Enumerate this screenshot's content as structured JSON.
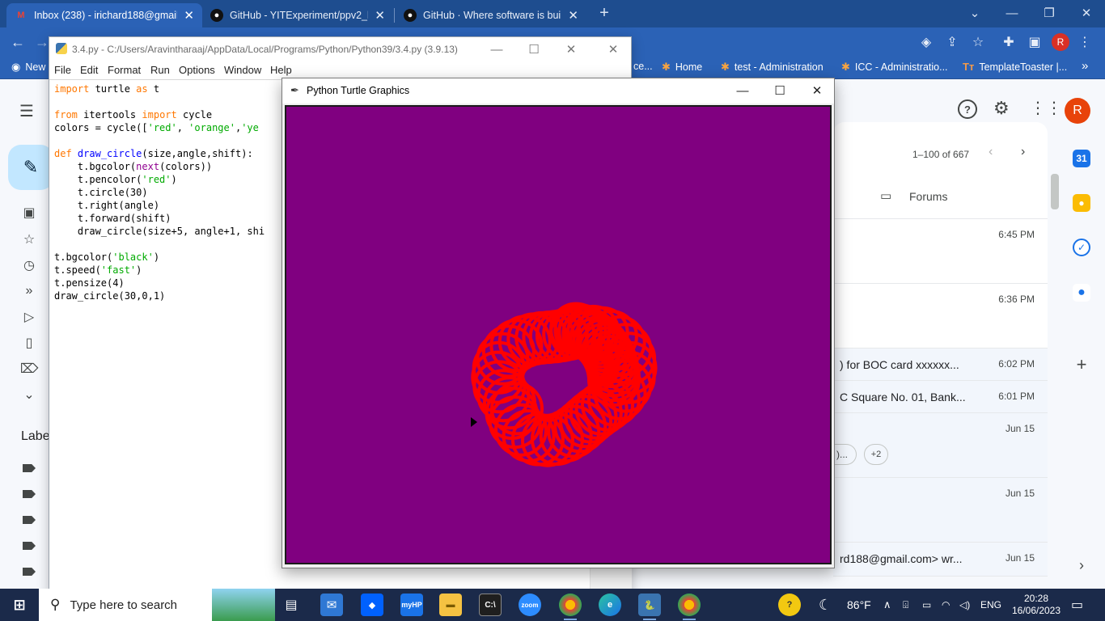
{
  "chrome": {
    "tabs": [
      {
        "title": "Inbox (238) - irichard188@gmail.",
        "favicon": "gmail-icon",
        "active": true
      },
      {
        "title": "GitHub - YITExperiment/ppv2_le",
        "favicon": "github-icon",
        "active": false
      },
      {
        "title": "GitHub · Where software is built",
        "favicon": "github-icon",
        "active": false
      }
    ],
    "new_tab": "+",
    "profile_initial": "R",
    "bookmarks": [
      {
        "label": "New",
        "icon": "chrome-icon"
      },
      {
        "label": "ce...",
        "icon": "none"
      },
      {
        "label": "Home",
        "icon": "joomla-icon"
      },
      {
        "label": "test - Administration",
        "icon": "joomla-icon"
      },
      {
        "label": "ICC - Administratio...",
        "icon": "joomla-icon"
      },
      {
        "label": "TemplateToaster |...",
        "icon": "templatetoaster-icon"
      }
    ],
    "bookmarks_more": "»"
  },
  "gmail": {
    "pagination": "1–100 of 667",
    "tab_forums": "Forums",
    "labels_heading": "Labe",
    "profile_initial": "R",
    "emails": [
      {
        "snippet": "",
        "date": "6:45 PM",
        "read": false
      },
      {
        "snippet": "",
        "date": "6:36 PM",
        "read": false
      },
      {
        "snippet": ") for BOC card xxxxxx...",
        "date": "6:02 PM",
        "read": true
      },
      {
        "snippet": "C Square No. 01, Bank...",
        "date": "6:01 PM",
        "read": true
      },
      {
        "snippet": "",
        "date": "Jun 15",
        "read": true,
        "chip": ")...",
        "chip_more": "+2"
      },
      {
        "snippet": "",
        "date": "Jun 15",
        "read": true
      },
      {
        "snippet": "rd188@gmail.com> wr...",
        "date": "Jun 15",
        "read": true
      }
    ]
  },
  "idle": {
    "title": "3.4.py - C:/Users/Aravintharaaj/AppData/Local/Programs/Python/Python39/3.4.py (3.9.13)",
    "menu": [
      "File",
      "Edit",
      "Format",
      "Run",
      "Options",
      "Window",
      "Help"
    ],
    "code": [
      [
        [
          "kw",
          "import"
        ],
        [
          "t",
          " turtle "
        ],
        [
          "kw",
          "as"
        ],
        [
          "t",
          " t"
        ]
      ],
      [],
      [
        [
          "kw",
          "from"
        ],
        [
          "t",
          " itertools "
        ],
        [
          "kw",
          "import"
        ],
        [
          "t",
          " cycle"
        ]
      ],
      [
        [
          "t",
          "colors = cycle(["
        ],
        [
          "str",
          "'red'"
        ],
        [
          "t",
          ", "
        ],
        [
          "str",
          "'orange'"
        ],
        [
          "t",
          ","
        ],
        [
          "str",
          "'ye"
        ]
      ],
      [],
      [
        [
          "kw",
          "def"
        ],
        [
          "t",
          " "
        ],
        [
          "def",
          "draw_circle"
        ],
        [
          "t",
          "(size,angle,shift):"
        ]
      ],
      [
        [
          "t",
          "    t.bgcolor("
        ],
        [
          "bi",
          "next"
        ],
        [
          "t",
          "(colors))"
        ]
      ],
      [
        [
          "t",
          "    t.pencolor("
        ],
        [
          "str",
          "'red'"
        ],
        [
          "t",
          ")"
        ]
      ],
      [
        [
          "t",
          "    t.circle(30)"
        ]
      ],
      [
        [
          "t",
          "    t.right(angle)"
        ]
      ],
      [
        [
          "t",
          "    t.forward(shift)"
        ]
      ],
      [
        [
          "t",
          "    draw_circle(size+5, angle+1, shi"
        ]
      ],
      [],
      [
        [
          "t",
          "t.bgcolor("
        ],
        [
          "str",
          "'black'"
        ],
        [
          "t",
          ")"
        ]
      ],
      [
        [
          "t",
          "t.speed("
        ],
        [
          "str",
          "'fast'"
        ],
        [
          "t",
          ")"
        ]
      ],
      [
        [
          "t",
          "t.pensize(4)"
        ]
      ],
      [
        [
          "t",
          "draw_circle(30,0,1)"
        ]
      ]
    ]
  },
  "turtle": {
    "title": "Python Turtle Graphics",
    "background_color": "#800080",
    "pen_color": "#ff0000"
  },
  "taskbar": {
    "search_placeholder": "Type here to search",
    "weather": "86°F",
    "language": "ENG",
    "time": "20:28",
    "date": "16/06/2023",
    "apps": [
      "task-view-icon",
      "mail-icon",
      "dropbox-icon",
      "myhp-icon",
      "file-explorer-icon",
      "terminal-icon",
      "zoom-icon",
      "chrome-profile-icon",
      "edge-icon",
      "python-idle-icon",
      "chrome-icon"
    ]
  }
}
